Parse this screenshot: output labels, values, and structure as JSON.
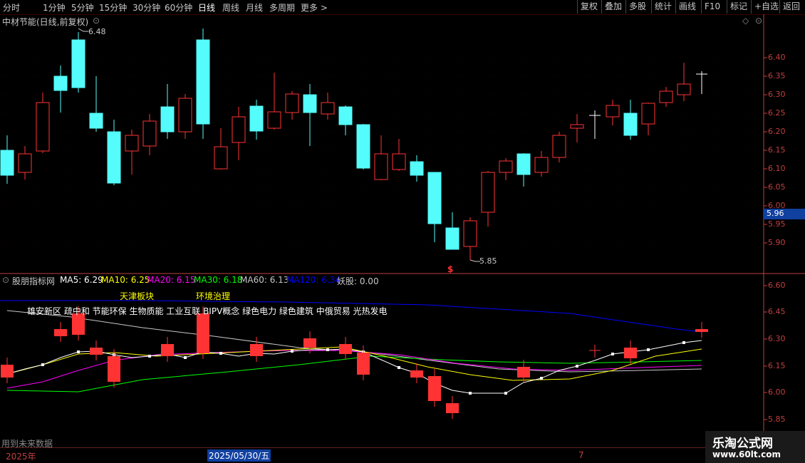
{
  "toolbar": {
    "periods": [
      "分时",
      "1分钟",
      "5分钟",
      "15分钟",
      "30分钟",
      "60分钟",
      "日线",
      "周线",
      "月线",
      "多周期",
      "更多 >"
    ],
    "active_period": "日线",
    "right_buttons": [
      "复权",
      "叠加",
      "多股",
      "统计",
      "画线",
      "F10",
      "标记",
      "+自选",
      "返回"
    ]
  },
  "main_panel": {
    "title": "中材节能(日线,前复权)",
    "price_labels": [
      "6.40",
      "6.35",
      "6.30",
      "6.25",
      "6.20",
      "6.15",
      "6.10",
      "6.05",
      "6.00",
      "5.95",
      "5.90"
    ],
    "current_price": "5.96",
    "high_mark": "6.48",
    "low_mark": "5.85",
    "signal_mark": "$"
  },
  "sub_panel": {
    "title": "股朋指标网",
    "ma": [
      {
        "label": "MA5: 6.29",
        "color": "#ffffff"
      },
      {
        "label": "MA10: 6.25",
        "color": "#ffff00"
      },
      {
        "label": "MA20: 6.15",
        "color": "#ff00ff"
      },
      {
        "label": "MA30: 6.18",
        "color": "#00ff00"
      },
      {
        "label": "MA60: 6.13",
        "color": "#c8c8c8"
      },
      {
        "label": "MA120: 6.34",
        "color": "#0000ff"
      },
      {
        "label": "妖股: 0.00",
        "color": "#c8c8c8"
      }
    ],
    "tag_yellow_1": "天津板块",
    "tag_yellow_2": "环境治理",
    "concepts": "雄安新区 疏中和 节能环保 生物质能 工业互联 BIPV概念 绿色电力 绿色建筑 中俄贸易 光热发电",
    "price_labels": [
      "6.60",
      "6.45",
      "6.30",
      "6.15",
      "6.00",
      "5.85"
    ],
    "footer_note": "用到未来数据"
  },
  "bottom": {
    "year": "2025年",
    "date": "2025/05/30/五",
    "month": "7"
  },
  "watermark": {
    "line1": "乐淘公式网",
    "line2": "www.60lt.com"
  },
  "colors": {
    "up": "#ff3333",
    "down": "#54fcfc",
    "axis": "#c04040",
    "grid": "#3a0000"
  }
}
